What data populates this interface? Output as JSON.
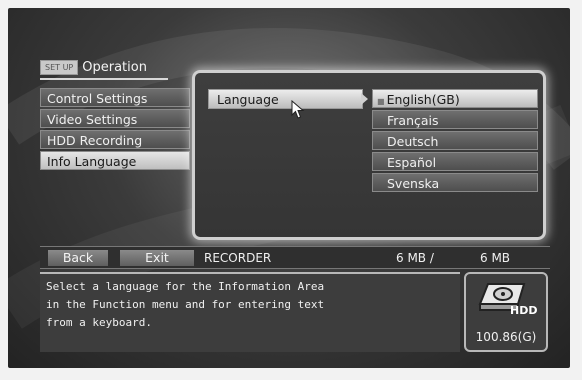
{
  "header": {
    "tag": "SET UP",
    "title": "Operation"
  },
  "menu": {
    "items": [
      {
        "label": "Control Settings",
        "active": false
      },
      {
        "label": "Video Settings",
        "active": false
      },
      {
        "label": "HDD Recording",
        "active": false
      },
      {
        "label": "Info Language",
        "active": true
      }
    ]
  },
  "setting": {
    "label": "Language"
  },
  "options": [
    {
      "label": "English(GB)",
      "selected": true
    },
    {
      "label": "Français",
      "selected": false
    },
    {
      "label": "Deutsch",
      "selected": false
    },
    {
      "label": "Español",
      "selected": false
    },
    {
      "label": "Svenska",
      "selected": false
    }
  ],
  "status_bar": {
    "back_label": "Back",
    "exit_label": "Exit",
    "source": "RECORDER",
    "used": "6 MB /",
    "total": "6 MB"
  },
  "info": {
    "lines": [
      "Select a language for the Information Area",
      "in the Function menu and for entering text",
      "from a keyboard."
    ]
  },
  "hdd": {
    "label": "HDD",
    "capacity": "100.86(G)"
  },
  "icons": [
    "hdd-icon",
    "pointer-cursor-icon",
    "submenu-arrow-icon"
  ]
}
